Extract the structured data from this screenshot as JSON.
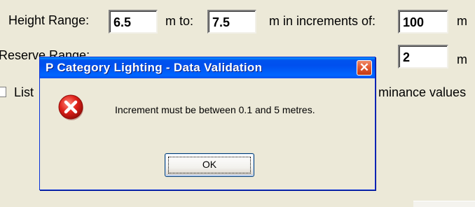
{
  "background": {
    "height_range": {
      "label": "Height Range:",
      "from_value": "6.5",
      "to_label": "m to:",
      "to_value": "7.5",
      "increments_label": "m in increments of:",
      "increment_value": "100",
      "unit": "m"
    },
    "reserve_range": {
      "label": "Reserve Range:",
      "increment_value": "2",
      "unit": "m"
    },
    "list_checkbox_label": "List",
    "luminance_text": "minance values"
  },
  "dialog": {
    "title": "P Category Lighting - Data Validation",
    "icon": "error-icon",
    "message": "Increment must be between 0.1 and 5 metres.",
    "ok_label": "OK",
    "close_glyph": "✕"
  },
  "colors": {
    "window_bg": "#ece9d8",
    "titlebar_blue": "#0054e3",
    "close_red": "#e35a32",
    "error_red": "#e0231c"
  }
}
